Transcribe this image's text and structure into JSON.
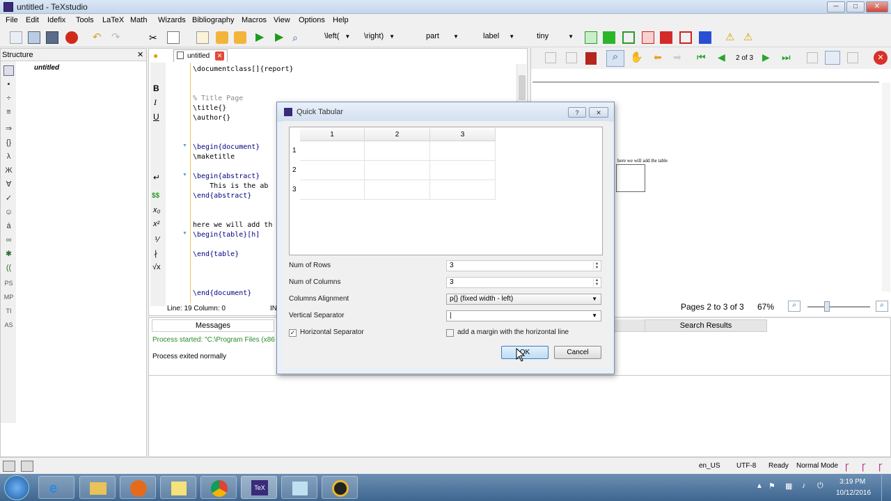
{
  "window": {
    "title": "untitled - TeXstudio",
    "min": "─",
    "max": "□",
    "close": "✕"
  },
  "menubar": [
    "File",
    "Edit",
    "Idefix",
    "Tools",
    "LaTeX",
    "Math",
    "Wizards",
    "Bibliography",
    "Macros",
    "View",
    "Options",
    "Help"
  ],
  "toolbar": {
    "left": "\\left(",
    "right": "\\right)",
    "part": "part",
    "label": "label",
    "size": "tiny"
  },
  "structure": {
    "title": "Structure",
    "close": "✕",
    "root": "untitled"
  },
  "editor": {
    "tab": "untitled",
    "tab_close": "✕",
    "lines": [
      "\\documentclass[]{report}",
      "",
      "",
      "% Title Page",
      "\\title{}",
      "\\author{}",
      "",
      "",
      "\\begin{document}",
      "\\maketitle",
      "",
      "\\begin{abstract}",
      "    This is the ab",
      "\\end{abstract}",
      "",
      "",
      "here we will add th",
      "\\begin{table}[h]",
      "",
      "\\end{table}",
      "",
      "",
      "",
      "\\end{document}"
    ],
    "status": "Line: 19   Column: 0",
    "status_extra": "IN"
  },
  "preview": {
    "page_indicator": "2 of 3",
    "pages": "Pages 2 to 3 of 3",
    "zoom": "67%",
    "doc_text": "here we will add the table"
  },
  "messages": {
    "tab": "Messages",
    "search_tab": "Search Results",
    "line1": "Process started: \"C:\\Program Files (x86",
    "line2": "Process exited normally"
  },
  "statusbar": {
    "lang": "en_US",
    "enc": "UTF-8",
    "state": "Ready",
    "mode": "Normal Mode"
  },
  "clock": {
    "time": "3:19 PM",
    "date": "10/12/2016"
  },
  "dialog": {
    "title": "Quick Tabular",
    "help": "?",
    "close": "✕",
    "col_headers": [
      "1",
      "2",
      "3"
    ],
    "row_headers": [
      "1",
      "2",
      "3"
    ],
    "num_rows_label": "Num of Rows",
    "num_rows": "3",
    "num_cols_label": "Num of Columns",
    "num_cols": "3",
    "align_label": "Columns Alignment",
    "align": "p{} (fixed width - left)",
    "vsep_label": "Vertical Separator",
    "vsep": "|",
    "hsep_label": "Horizontal Separator",
    "hsep_checked": "✓",
    "margin_label": "add a margin with the horizontal line",
    "ok": "OK",
    "cancel": "Cancel"
  }
}
